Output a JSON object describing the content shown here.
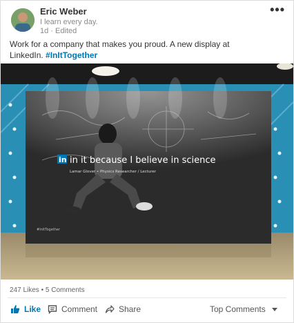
{
  "post": {
    "author": "Eric Weber",
    "headline": "I learn every day.",
    "time": "1d",
    "edited": "Edited",
    "text": "Work for a company that makes you proud. A new display at LinkedIn.",
    "hashtag": "#InItTogether"
  },
  "photo": {
    "banner_text": "in it because I believe in science",
    "caption": "Lamar Glover • Physics Researcher / Lecturer",
    "corner_tag": "#InItTogether"
  },
  "stats": {
    "likes": "247 Likes",
    "separator": "•",
    "comments": "5 Comments"
  },
  "actions": {
    "like": "Like",
    "comment": "Comment",
    "share": "Share",
    "sort": "Top Comments"
  },
  "colors": {
    "accent": "#0077b5",
    "wall": "#2a8fb5"
  }
}
